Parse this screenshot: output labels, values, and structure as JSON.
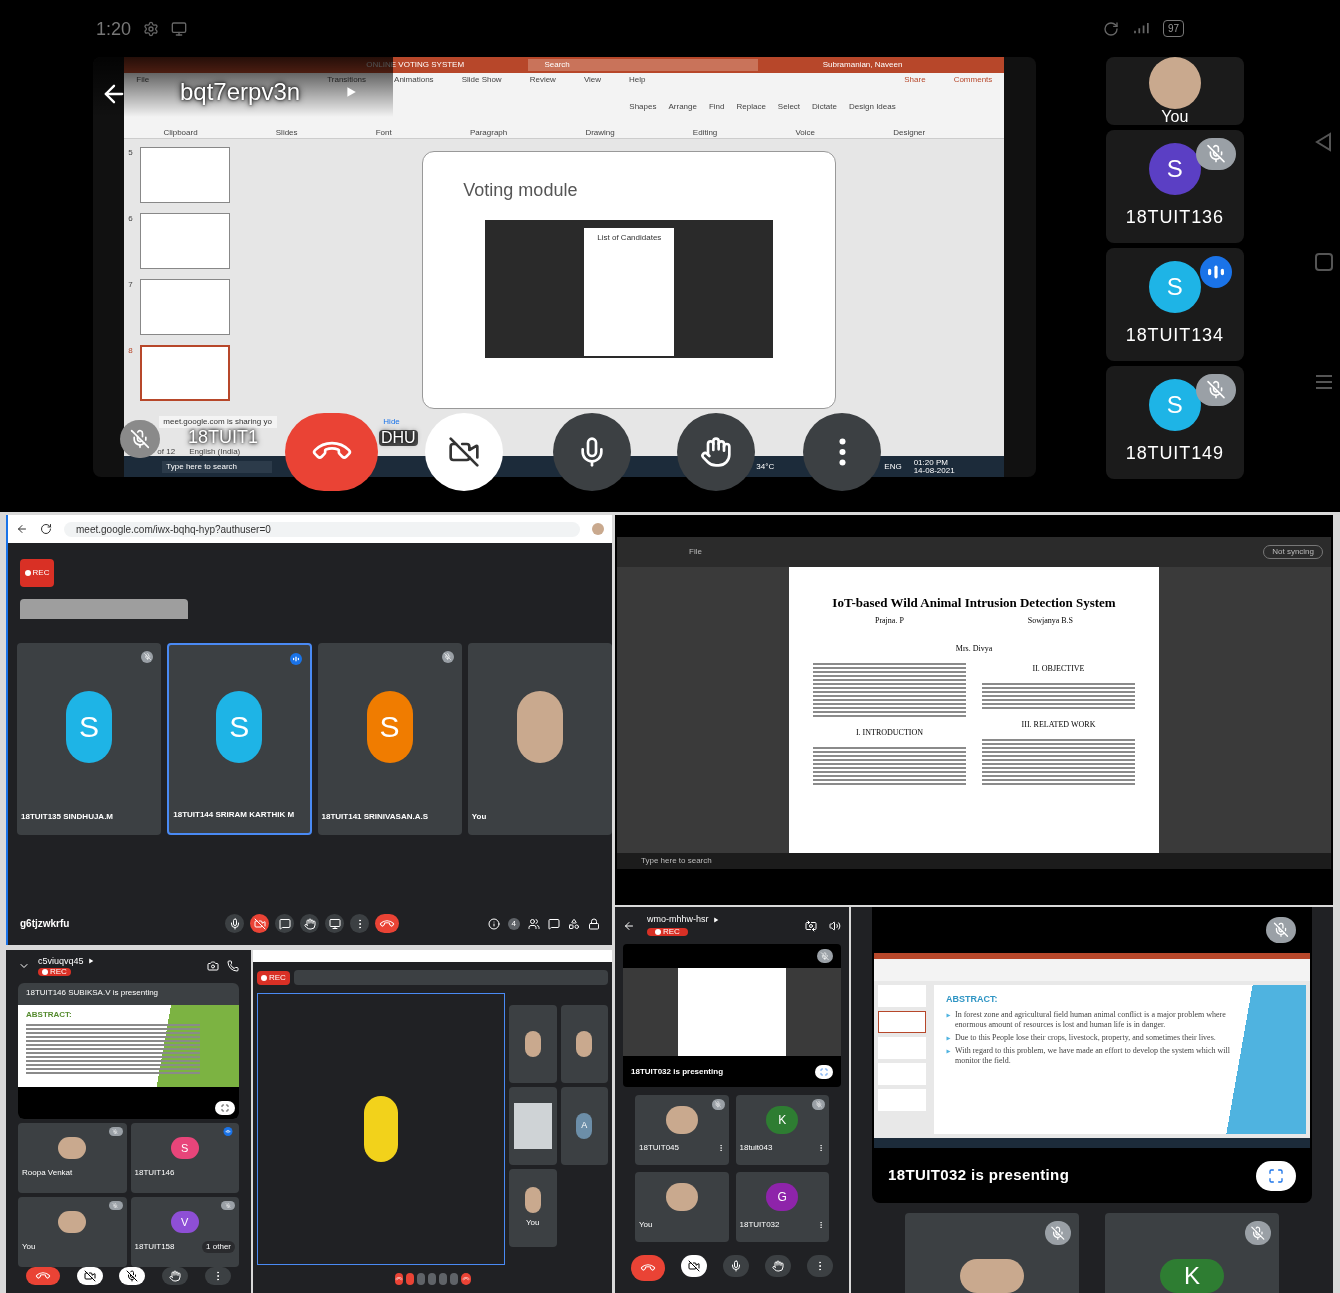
{
  "phone_status": {
    "time": "1:20",
    "battery": "97"
  },
  "top_call": {
    "meeting_code": "bqt7erpv3n",
    "name_fragments": [
      "18TUIT1",
      "DHU"
    ],
    "powerpoint": {
      "title": "ONLINE VOTING SYSTEM",
      "search": "Search",
      "user": "Subramanian, Naveen",
      "share": "Share",
      "comments": "Comments",
      "tabs": [
        "File",
        "Transitions",
        "Animations",
        "Slide Show",
        "Review",
        "View",
        "Help"
      ],
      "ribbon_buttons": [
        "Shapes",
        "Arrange",
        "Find",
        "Replace",
        "Select",
        "Dictate",
        "Design Ideas"
      ],
      "ribbon_groups": [
        "Clipboard",
        "Slides",
        "Font",
        "Paragraph",
        "Drawing",
        "Editing",
        "Voice",
        "Designer"
      ],
      "thumbnails": [
        {
          "number": "5",
          "selected": false
        },
        {
          "number": "6",
          "selected": false
        },
        {
          "number": "7",
          "selected": false
        },
        {
          "number": "8",
          "selected": true
        }
      ],
      "slide_title": "Voting module",
      "popup_title": "List of Candidates",
      "status": [
        "of 12",
        "English (India)"
      ],
      "sharing_bar": {
        "text": "meet.google.com is sharing yo",
        "button": "Hide"
      },
      "taskbar": {
        "search": "Type here to search",
        "weather": "34°C",
        "language": "ENG",
        "time": "01:20 PM",
        "date": "14-08-2021"
      }
    },
    "participants": [
      {
        "name": "You",
        "kind": "photo",
        "muted": false,
        "speaking": false
      },
      {
        "name": "18TUIT136",
        "kind": "initial",
        "initial": "S",
        "color": "#5b3fc4",
        "muted": true,
        "speaking": false
      },
      {
        "name": "18TUIT134",
        "kind": "initial",
        "initial": "S",
        "color": "#1eb4e6",
        "muted": false,
        "speaking": true
      },
      {
        "name": "18TUIT149",
        "kind": "initial",
        "initial": "S",
        "color": "#1eb4e6",
        "muted": true,
        "speaking": false
      }
    ]
  },
  "desktop_meet": {
    "url": "meet.google.com/iwx-bqhq-hyp?authuser=0",
    "rec": "REC",
    "meeting_code": "g6tjzwkrfu",
    "people_count": "4",
    "tiles": [
      {
        "name": "18TUIT135 SINDHUJA.M",
        "kind": "initial",
        "initial": "S",
        "color": "#1eb4e6",
        "muted": true,
        "speaking": false,
        "selected": false
      },
      {
        "name": "18TUIT144 SRIRAM KARTHIK M",
        "kind": "initial",
        "initial": "S",
        "color": "#1eb4e6",
        "muted": false,
        "speaking": true,
        "selected": true
      },
      {
        "name": "18TUIT141 SRINIVASAN.A.S",
        "kind": "initial",
        "initial": "S",
        "color": "#f07c00",
        "muted": true,
        "speaking": false,
        "selected": false
      },
      {
        "name": "You",
        "kind": "photo",
        "muted": false,
        "speaking": false,
        "selected": false
      }
    ]
  },
  "pdf_share": {
    "address_label": "File",
    "sync_button": "Not syncing",
    "title": "IoT-based Wild Animal Intrusion Detection System",
    "authors": [
      "Prajna. P",
      "Sowjanya B.S"
    ],
    "advisor": "Mrs. Divya",
    "headings": [
      "I. INTRODUCTION",
      "II. OBJECTIVE",
      "III. RELATED WORK"
    ],
    "taskbar_search": "Type here to search"
  },
  "phone_call_a": {
    "meeting_code": "c5viuqvq45",
    "rec": "REC",
    "presenting": "18TUIT146 SUBIKSA.V is presenting",
    "slide_heading": "ABSTRACT:",
    "tiles": [
      {
        "name": "Roopa Venkat",
        "kind": "photo",
        "muted": true,
        "speaking": false
      },
      {
        "name": "18TUIT146",
        "kind": "initial",
        "initial": "S",
        "color": "#e8457a",
        "muted": false,
        "speaking": true
      },
      {
        "name": "You",
        "kind": "photo",
        "muted": true,
        "speaking": false
      },
      {
        "name": "18TUIT158",
        "kind": "initial",
        "initial": "V",
        "color": "#8e4fd6",
        "muted": true,
        "speaking": false,
        "extra": "1 other"
      }
    ]
  },
  "desktop_meet_b": {
    "rec": "REC",
    "tiles": [
      {
        "kind": "photo"
      },
      {
        "kind": "photo"
      },
      {
        "kind": "screen"
      },
      {
        "kind": "initial",
        "initial": "A",
        "color": "#6c8ea8"
      },
      {
        "kind": "photo",
        "label": "You"
      }
    ]
  },
  "phone_call_c": {
    "meeting_code": "wmo-mhhw-hsr",
    "rec": "REC",
    "presenting": "18TUIT032 is presenting",
    "presenter_muted": true,
    "tiles": [
      {
        "name": "18TUIT045",
        "kind": "photo",
        "muted": true,
        "speaking": false
      },
      {
        "name": "18tuit043",
        "kind": "initial",
        "initial": "K",
        "color": "#2e7d32",
        "muted": true,
        "speaking": false
      },
      {
        "name": "You",
        "kind": "photo",
        "muted": false,
        "speaking": false
      },
      {
        "name": "18TUIT032",
        "kind": "initial",
        "initial": "G",
        "color": "#8e24aa",
        "muted": false,
        "speaking": false
      }
    ]
  },
  "phone_call_d": {
    "presenting": "18TUIT032 is presenting",
    "presenter_muted": true,
    "slide_heading": "ABSTRACT:",
    "bullets": [
      "In forest zone and agricultural field human animal conflict is a major problem where enormous amount of resources is lost and human life is in danger.",
      "Due to this People lose their crops, livestock, property, and sometimes their lives.",
      "With regard to this problem, we have made an effort to develop the system which will monitor the field."
    ],
    "tiles": [
      {
        "kind": "photo",
        "muted": true,
        "speaking": false
      },
      {
        "kind": "initial",
        "initial": "K",
        "color": "#2e7d32",
        "muted": true,
        "speaking": false
      }
    ]
  }
}
